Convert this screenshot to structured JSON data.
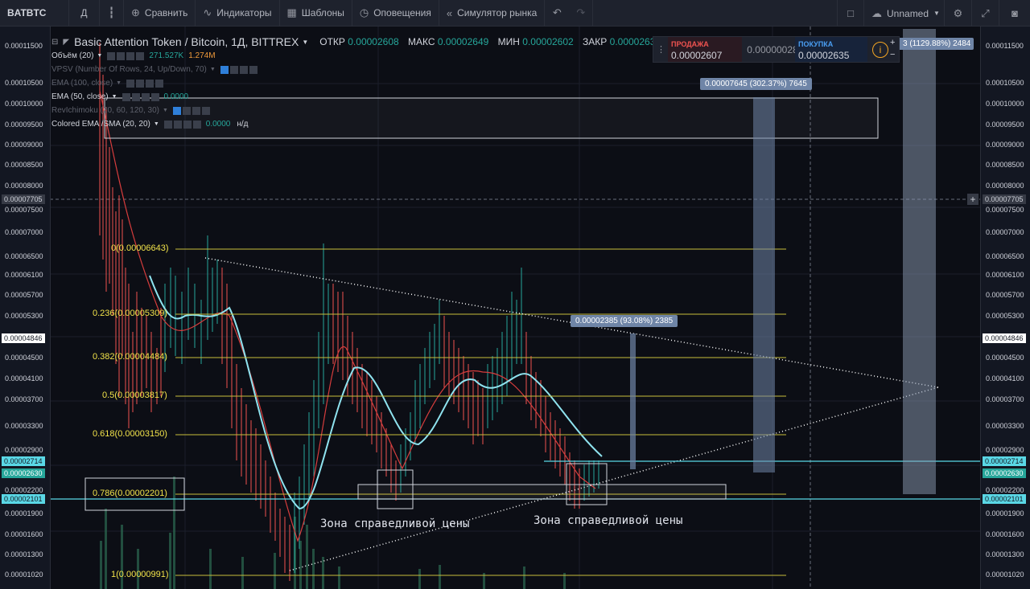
{
  "toolbar": {
    "symbol": "BATBTC",
    "interval": "Д",
    "compare": "Сравнить",
    "indicators": "Индикаторы",
    "templates": "Шаблоны",
    "alerts": "Оповещения",
    "replay": "Симулятор рынка",
    "layout_name": "Unnamed"
  },
  "header": {
    "title": "Basic Attention Token / Bitcoin, 1Д, BITTREX",
    "open_label": "ОТКР",
    "open": "0.00002608",
    "high_label": "МАКС",
    "high": "0.00002649",
    "low_label": "МИН",
    "low": "0.00002602",
    "close_label": "ЗАКР",
    "close": "0.00002630"
  },
  "legend": {
    "volume": "Объём (20)",
    "volume_v1": "271.527K",
    "volume_v2": "1.274M",
    "vpsv": "VPSV (Number Of Rows, 24, Up/Down, 70)",
    "ema100": "EMA (100, close)",
    "ema50": "EMA (50, close)",
    "ema50_val": "0.0000",
    "ichimoku": "RevIchimoku (20, 60, 120, 30)",
    "colored": "Colored EMA /SMA (20, 20)",
    "colored_val": "0.0000",
    "colored_na": "н/д"
  },
  "trade_panel": {
    "sell_label": "ПРОДАЖА",
    "sell_price": "0.00002607",
    "spread": "0.00000028",
    "buy_label": "ПОКУПКА",
    "buy_price": "0.00002635"
  },
  "axis": {
    "ticks": [
      "0.00011500",
      "0.00010500",
      "0.00010000",
      "0.00009500",
      "0.00009000",
      "0.00008500",
      "0.00008000",
      "0.00007500",
      "0.00007000",
      "0.00006500",
      "0.00006100",
      "0.00005700",
      "0.00005300",
      "0.00004500",
      "0.00004100",
      "0.00003700",
      "0.00003300",
      "0.00002900",
      "0.00002200",
      "0.00001900",
      "0.00001600",
      "0.00001300",
      "0.00001020"
    ],
    "tag_crosshair": "0.00007705",
    "tag_4846": "0.00004846",
    "tag_2714": "0.00002714",
    "tag_2630": "0.00002630",
    "tag_2101": "0.00002101"
  },
  "fib": [
    {
      "label": "0(0.00006643)"
    },
    {
      "label": "0.236(0.00005309)"
    },
    {
      "label": "0.382(0.00004484)"
    },
    {
      "label": "0.5(0.00003817)"
    },
    {
      "label": "0.618(0.00003150)"
    },
    {
      "label": "0.786(0.00002201)"
    },
    {
      "label": "1(0.00000991)"
    }
  ],
  "callouts": {
    "c1": "0.00007645 (302.37%) 7645",
    "c2": "0.00002385 (93.08%) 2385",
    "c3": "3 (1129.88%) 2484"
  },
  "zones": {
    "z1": "Зона справедливой цены",
    "z2": "Зона справедливой цены"
  },
  "colors": {
    "accent": "#5ad8e6",
    "fib": "#f2e34a",
    "up": "#26a69a",
    "down": "#ef5350",
    "ema": "#8fe3ef"
  }
}
